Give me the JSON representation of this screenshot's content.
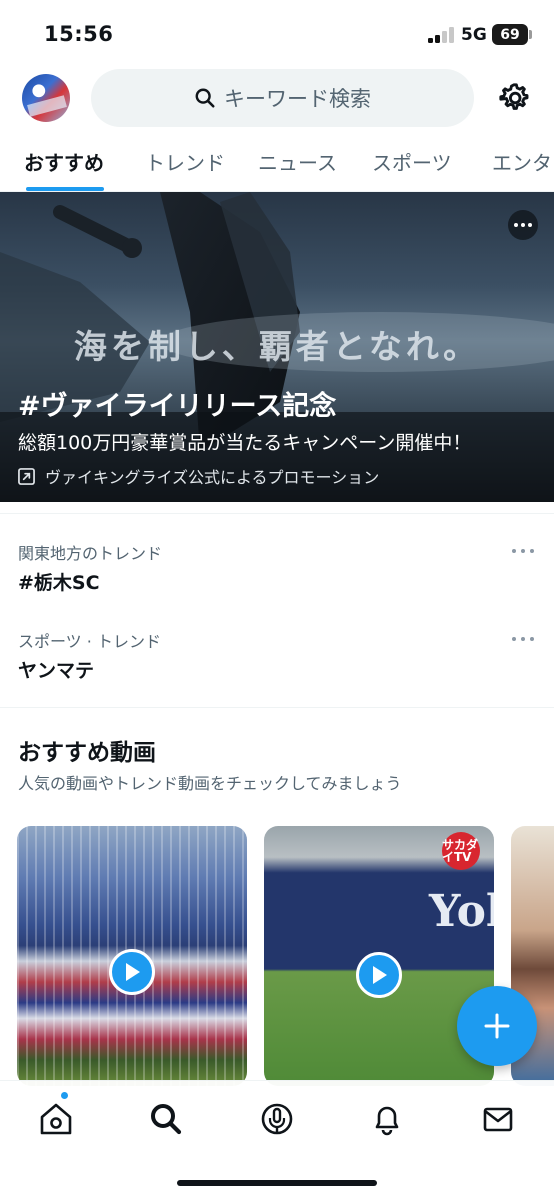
{
  "status_bar": {
    "time": "15:56",
    "network": "5G",
    "battery": "69"
  },
  "header": {
    "search_placeholder": "キーワード検索"
  },
  "tabs": [
    {
      "label": "おすすめ",
      "active": true
    },
    {
      "label": "トレンド",
      "active": false
    },
    {
      "label": "ニュース",
      "active": false
    },
    {
      "label": "スポーツ",
      "active": false
    },
    {
      "label": "エンタ",
      "active": false
    }
  ],
  "promo": {
    "tagline": "海を制し、覇者となれ。",
    "title": "#ヴァイライリリース記念",
    "subtitle": "総額100万円豪華賞品が当たるキャンペーン開催中！",
    "promoted_by": "ヴァイキングライズ公式によるプロモーション"
  },
  "trends": [
    {
      "context": "関東地方のトレンド",
      "name": "#栃木SC"
    },
    {
      "context": "スポーツ · トレンド",
      "name": "ヤンマテ"
    }
  ],
  "recommended_videos": {
    "title": "おすすめ動画",
    "subtitle": "人気の動画やトレンド動画をチェックしてみましょう",
    "thumbnails": [
      {
        "overlay_text": ""
      },
      {
        "overlay_text": "Yok",
        "badge": "サカダイTV"
      },
      {
        "overlay_text": ""
      }
    ]
  },
  "bottom_nav": {
    "items": [
      "home-icon",
      "search-icon",
      "spaces-icon",
      "notifications-icon",
      "messages-icon"
    ],
    "active": "search-icon"
  },
  "colors": {
    "accent": "#1d9bf0",
    "text": "#0f1419",
    "secondary": "#536471"
  }
}
